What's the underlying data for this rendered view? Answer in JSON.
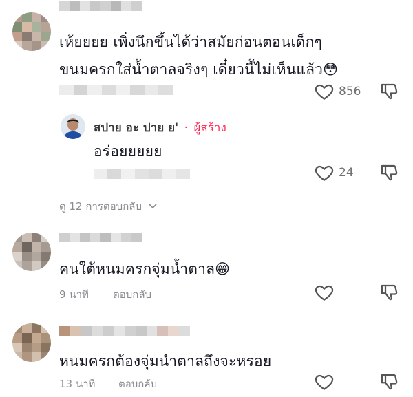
{
  "comments": [
    {
      "text_lines": [
        "เห้ยยยย เพิ่งนึกขึ้นได้ว่าสมัยก่อนตอนเด็กๆ",
        "ขนมครกใส่น้ำตาลจริงๆ เดี๋ยวนี้ไม่เห็นแล้ว😳"
      ],
      "likes": "856",
      "reply": {
        "author": "สปาย อะ ปาย ย'",
        "separator": "·",
        "creator_badge": "ผู้สร้าง",
        "text": "อร่อยยยยย",
        "likes": "24"
      },
      "view_replies": "ดู 12 การตอบกลับ"
    },
    {
      "text": "คนใต้หนมครกจุ่มน้ำตาล😁",
      "time": "9 นาที",
      "reply_label": "ตอบกลับ"
    },
    {
      "text": "หนมครกต้องจุ่มนำตาลถึงจะหรอย",
      "time": "13 นาที",
      "reply_label": "ตอบกลับ"
    }
  ],
  "icons": {
    "like": "heart-outline-icon",
    "dislike": "thumbs-down-outline-icon",
    "chevron": "chevron-down-icon"
  },
  "colors": {
    "creator_badge": "#fe2c55",
    "muted": "#8a8b91"
  }
}
